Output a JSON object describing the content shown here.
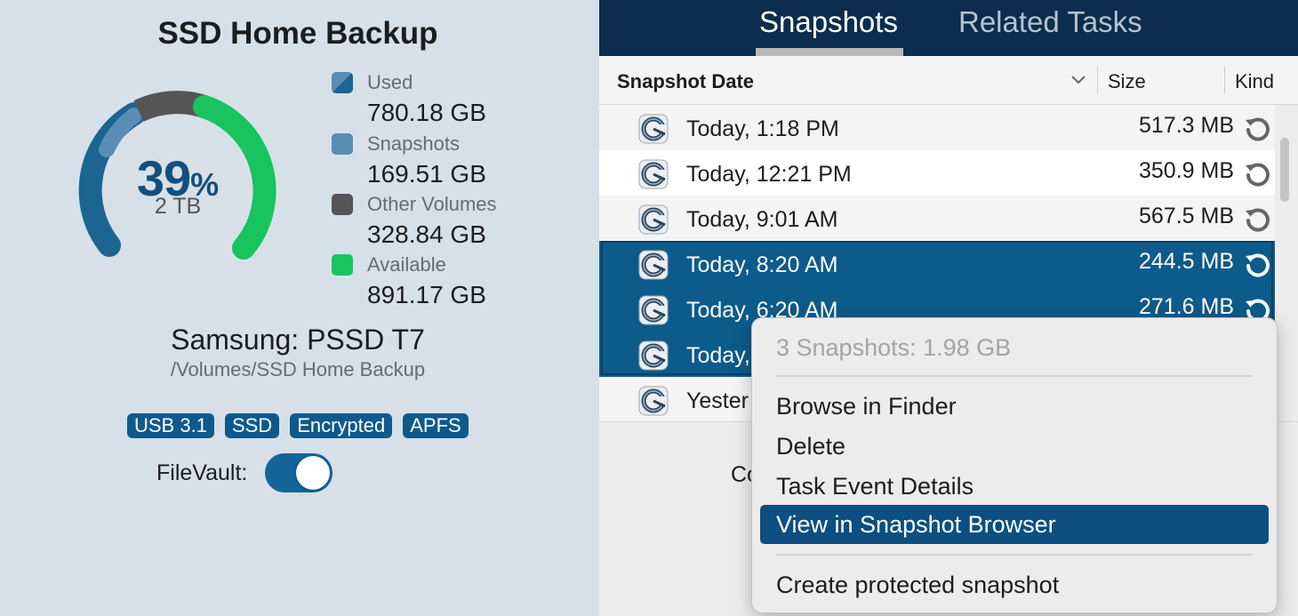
{
  "volume": {
    "title": "SSD Home Backup",
    "percent_number": "39",
    "percent_symbol": "%",
    "capacity": "2 TB",
    "device_name": "Samsung: PSSD T7",
    "path": "/Volumes/SSD Home Backup",
    "badges": [
      "USB 3.1",
      "SSD",
      "Encrypted",
      "APFS"
    ],
    "filevault_label": "FileVault:",
    "filevault_on": true
  },
  "legend": [
    {
      "label": "Used",
      "value": "780.18 GB",
      "color": "#1c6591"
    },
    {
      "label": "Snapshots",
      "value": "169.51 GB",
      "color": "#5a8db3"
    },
    {
      "label": "Other Volumes",
      "value": "328.84 GB",
      "color": "#555555"
    },
    {
      "label": "Available",
      "value": "891.17 GB",
      "color": "#17c45e"
    }
  ],
  "gauge_colors": {
    "used": "#1c6591",
    "snapshots": "#5a8db3",
    "other": "#555555",
    "available": "#17c45e",
    "text": "#14507e"
  },
  "tabs": [
    {
      "label": "Snapshots",
      "active": true
    },
    {
      "label": "Related Tasks",
      "active": false
    }
  ],
  "table": {
    "col_date": "Snapshot Date",
    "col_size": "Size",
    "col_kind": "Kind",
    "rows": [
      {
        "date": "Today, 1:18 PM",
        "size": "517.3 MB",
        "selected": false
      },
      {
        "date": "Today, 12:21 PM",
        "size": "350.9 MB",
        "selected": false
      },
      {
        "date": "Today, 9:01 AM",
        "size": "567.5 MB",
        "selected": false
      },
      {
        "date": "Today, 8:20 AM",
        "size": "244.5 MB",
        "selected": true
      },
      {
        "date": "Today, 6:20 AM",
        "size": "271.6 MB",
        "selected": true
      },
      {
        "date": "Today,",
        "size": "",
        "selected": true
      },
      {
        "date": "Yester",
        "size": "",
        "selected": false
      }
    ]
  },
  "background_fragment": "Co",
  "context_menu": {
    "header": "3 Snapshots: 1.98 GB",
    "items": [
      {
        "label": "Browse in Finder"
      },
      {
        "label": "Delete"
      },
      {
        "label": "Task Event Details"
      },
      {
        "label": "View in Snapshot Browser"
      },
      {
        "label": "Create protected snapshot"
      }
    ]
  }
}
